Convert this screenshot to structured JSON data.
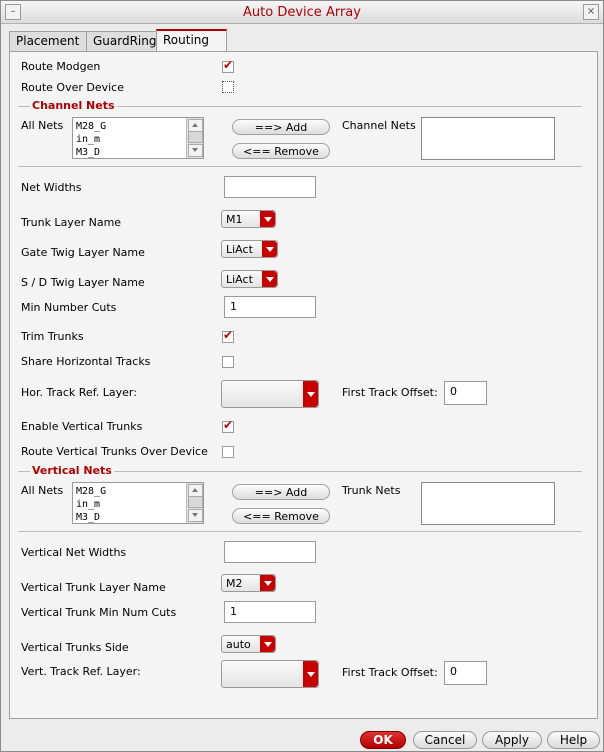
{
  "window": {
    "title": "Auto Device Array",
    "minimize_glyph": "–",
    "close_glyph": "⨯"
  },
  "tabs": [
    {
      "label": "Placement",
      "active": false
    },
    {
      "label": "GuardRing",
      "active": false
    },
    {
      "label": "Routing",
      "active": true
    }
  ],
  "routing": {
    "route_modgen": {
      "label": "Route Modgen",
      "checked": true
    },
    "route_over_device": {
      "label": "Route Over Device",
      "checked": false
    },
    "channel_nets_section": "Channel Nets",
    "all_nets_label": "All Nets",
    "all_nets_list": [
      "M28_G",
      "in_m",
      "M3_D"
    ],
    "add_label": "==> Add",
    "remove_label": "<== Remove",
    "channel_nets_label": "Channel Nets",
    "net_widths": {
      "label": "Net Widths",
      "value": ""
    },
    "trunk_layer_name": {
      "label": "Trunk Layer Name",
      "value": "M1"
    },
    "gate_twig_layer_name": {
      "label": "Gate Twig Layer Name",
      "value": "LiAct"
    },
    "sd_twig_layer_name": {
      "label": "S / D Twig Layer Name",
      "value": "LiAct"
    },
    "min_number_cuts": {
      "label": "Min Number Cuts",
      "value": "1"
    },
    "trim_trunks": {
      "label": "Trim Trunks",
      "checked": true
    },
    "share_horizontal_tracks": {
      "label": "Share Horizontal Tracks",
      "checked": false
    },
    "hor_track_ref_layer": {
      "label": "Hor. Track Ref. Layer:",
      "value": ""
    },
    "first_track_offset_1": {
      "label": "First Track Offset:",
      "value": "0"
    },
    "enable_vertical_trunks": {
      "label": "Enable Vertical Trunks",
      "checked": true
    },
    "route_vertical_trunks_over_device": {
      "label": "Route Vertical Trunks Over Device",
      "checked": false
    },
    "vertical_nets_section": "Vertical Nets",
    "all_nets_label_2": "All Nets",
    "all_nets_list_2": [
      "M28_G",
      "in_m",
      "M3_D"
    ],
    "trunk_nets_label": "Trunk Nets",
    "vertical_net_widths": {
      "label": "Vertical Net Widths",
      "value": ""
    },
    "vertical_trunk_layer_name": {
      "label": "Vertical Trunk Layer Name",
      "value": "M2"
    },
    "vertical_trunk_min_num_cuts": {
      "label": "Vertical Trunk Min Num Cuts",
      "value": "1"
    },
    "vertical_trunks_side": {
      "label": "Vertical Trunks Side",
      "value": "auto"
    },
    "vert_track_ref_layer": {
      "label": "Vert. Track Ref. Layer:",
      "value": ""
    },
    "first_track_offset_2": {
      "label": "First Track Offset:",
      "value": "0"
    }
  },
  "buttons": {
    "ok": "OK",
    "cancel": "Cancel",
    "apply": "Apply",
    "help": "Help"
  },
  "colors": {
    "accent": "#b00000",
    "checkmark": "#c00000"
  }
}
